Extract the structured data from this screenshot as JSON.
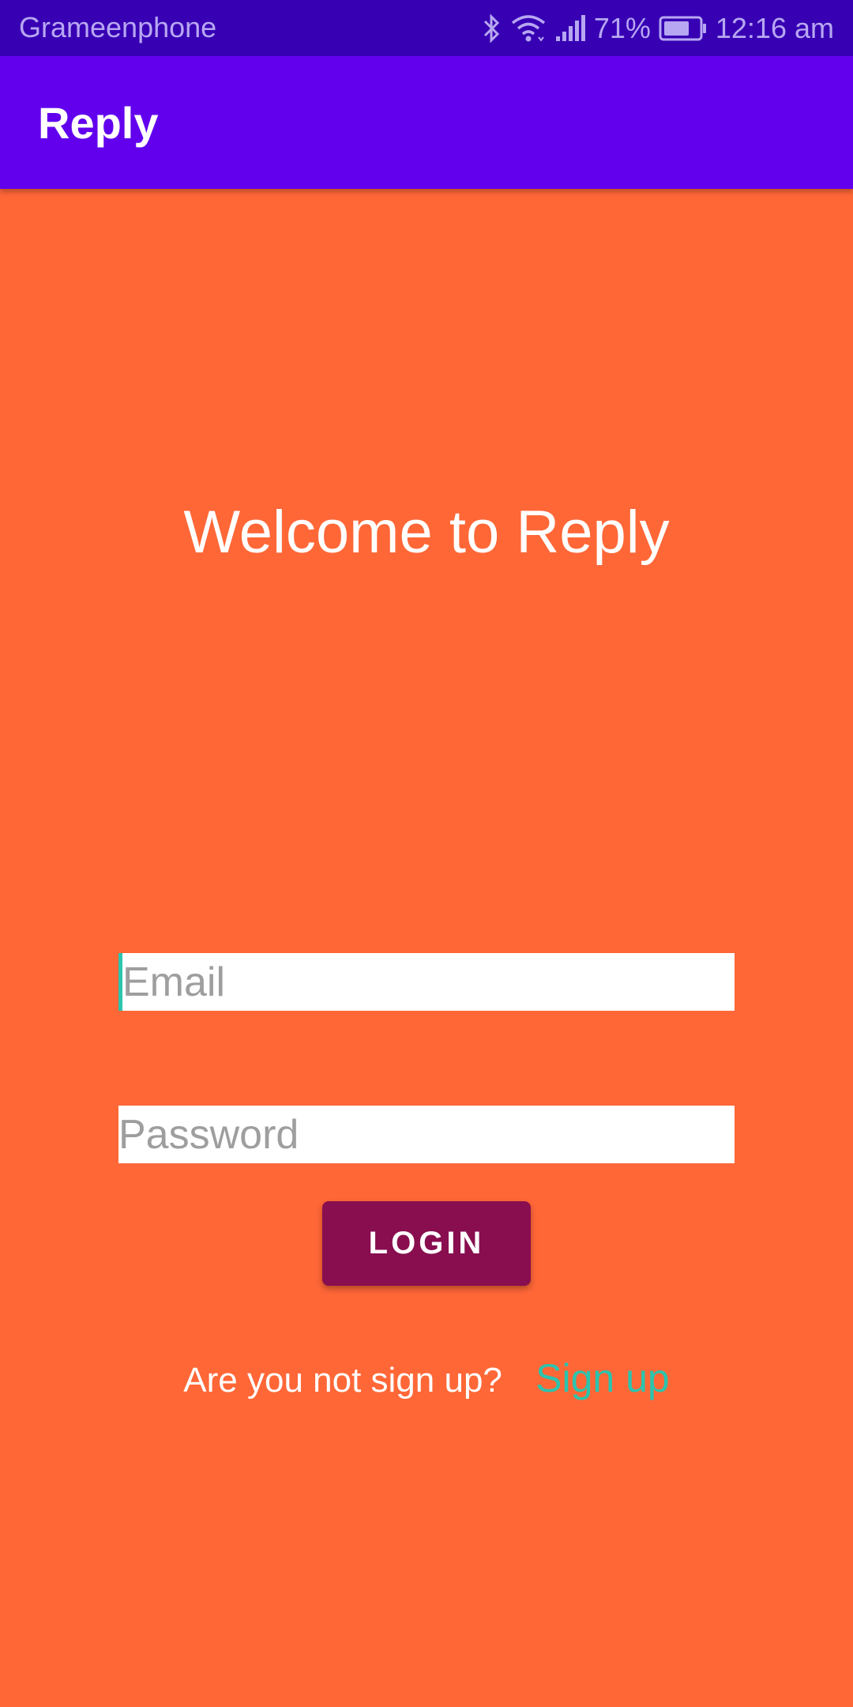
{
  "status_bar": {
    "carrier": "Grameenphone",
    "battery": "71%",
    "time": "12:16 am",
    "icons": [
      "bluetooth-icon",
      "wifi-icon",
      "signal-icon",
      "battery-icon"
    ]
  },
  "app_bar": {
    "title": "Reply"
  },
  "main": {
    "welcome": "Welcome to Reply",
    "email_placeholder": "Email",
    "email_value": "",
    "password_placeholder": "Password",
    "password_value": "",
    "login_label": "LOGIN",
    "signup_question": "Are you not sign up?",
    "signup_link": "Sign up"
  },
  "colors": {
    "status_bar": "#3700B3",
    "app_bar": "#6200EE",
    "background": "#FF6737",
    "button": "#880E4F",
    "accent": "#2BC4AE"
  }
}
